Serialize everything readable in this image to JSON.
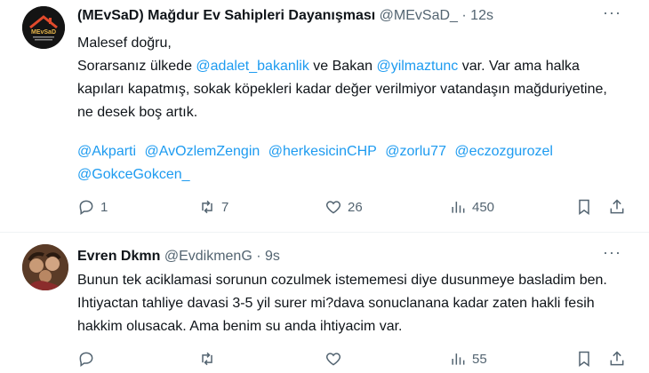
{
  "tweets": [
    {
      "author_name": "(MEvSaD) Mağdur Ev Sahipleri Dayanışması",
      "handle": "@MEvSaD_",
      "separator": "·",
      "time": "12s",
      "avatar_text": "MEvSaD",
      "body_line1": "Malesef doğru,",
      "body_line2_a": "Sorarsanız ülkede ",
      "body_line2_mention1": "@adalet_bakanlik",
      "body_line2_b": " ve Bakan ",
      "body_line2_mention2": "@yilmaztunc",
      "body_line2_c": " var. Var ama halka kapıları kapatmış, sokak köpekleri kadar değer verilmiyor vatandaşın mağduriyetine, ne desek boş artık.",
      "mentions": [
        "@Akparti",
        "@AvOzlemZengin",
        "@herkesicinCHP",
        "@zorlu77",
        "@eczozgurozel",
        "@GokceGokcen_"
      ],
      "replies": "1",
      "reposts": "7",
      "likes": "26",
      "views": "450"
    },
    {
      "author_name": "Evren Dkmn",
      "handle": "@EvdikmenG",
      "separator": "·",
      "time": "9s",
      "body": "Bunun tek aciklamasi sorunun cozulmek istememesi diye dusunmeye basladim ben. Ihtiyactan tahliye davasi 3-5 yil surer mi?dava sonuclanana kadar zaten hakli fesih hakkim olusacak. Ama benim su anda ihtiyacim var.",
      "replies": "",
      "reposts": "",
      "likes": "",
      "views": "55"
    }
  ],
  "colors": {
    "accent": "#1d9bf0",
    "text": "#0f1419",
    "secondary": "#536471",
    "divider": "#eff3f4"
  }
}
